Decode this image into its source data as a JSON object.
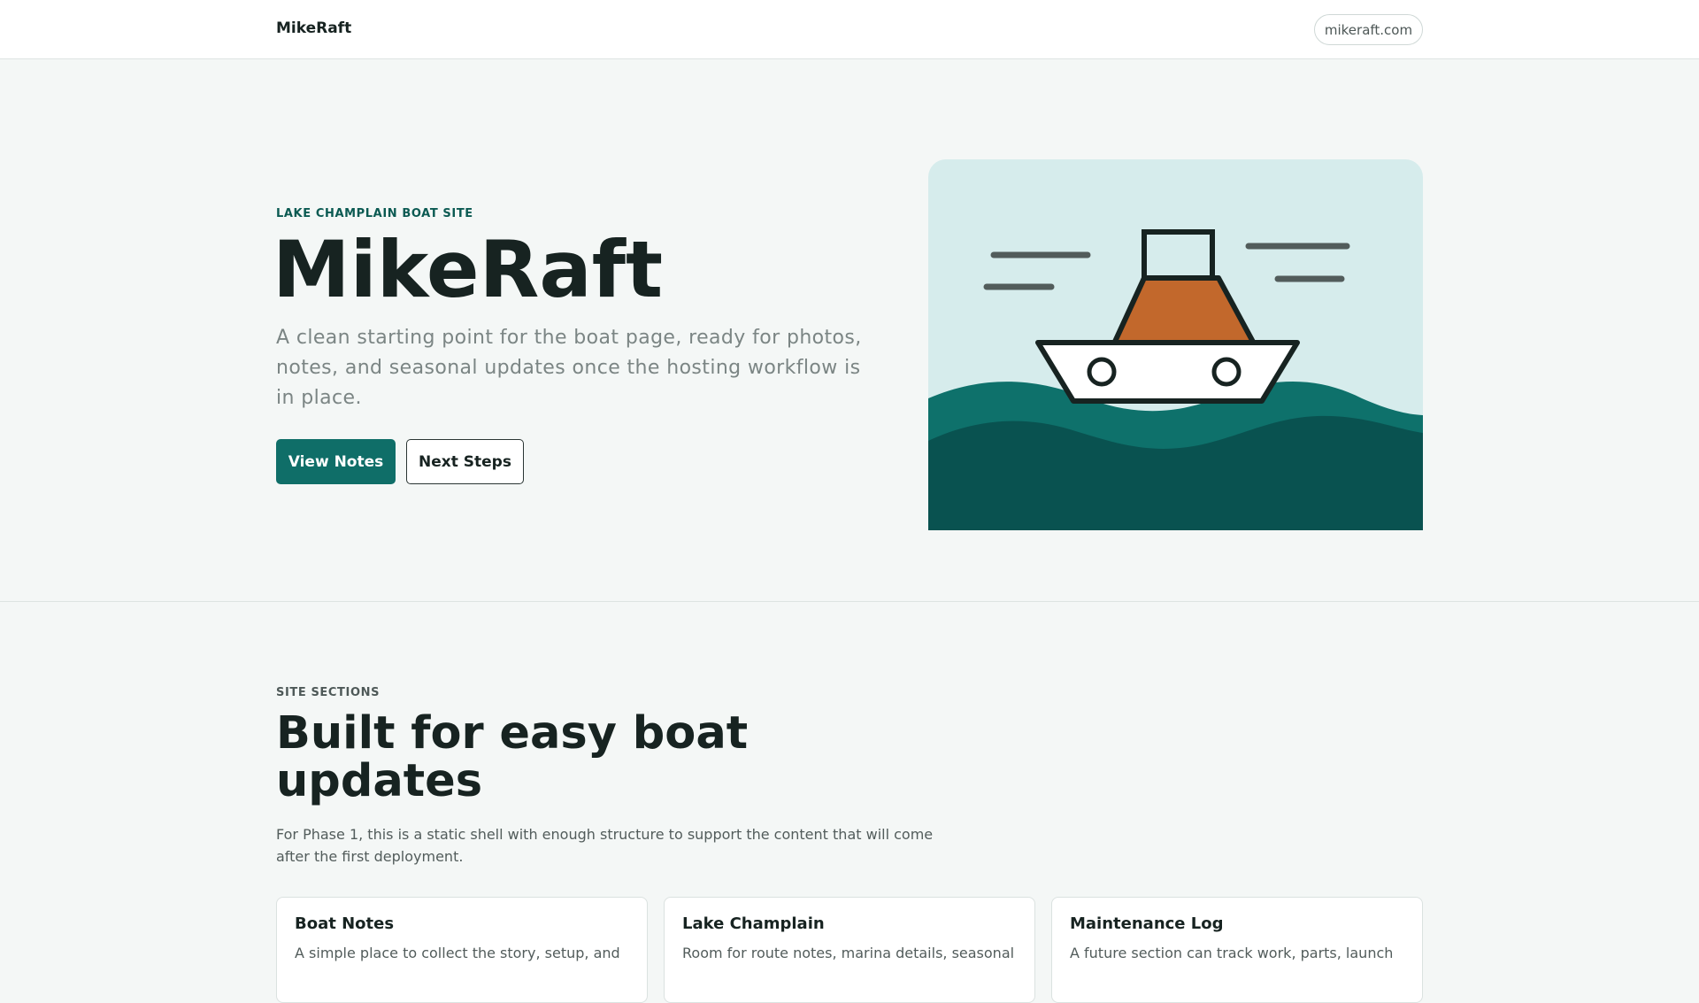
{
  "header": {
    "brand": "MikeRaft",
    "domain": "mikeraft.com"
  },
  "hero": {
    "eyebrow": "LAKE CHAMPLAIN BOAT SITE",
    "title": "MikeRaft",
    "subtitle": "A clean starting point for the boat page, ready for photos, notes, and seasonal updates once the hosting workflow is in place.",
    "primary_button": "View Notes",
    "secondary_button": "Next Steps",
    "illustration": "boat-on-waves-illustration"
  },
  "sections": {
    "eyebrow": "SITE SECTIONS",
    "title": "Built for easy boat updates",
    "description": "For Phase 1, this is a static shell with enough structure to support the content that will come after the first deployment.",
    "cards": [
      {
        "title": "Boat Notes",
        "text": "A simple place to collect the story, setup, and"
      },
      {
        "title": "Lake Champlain",
        "text": "Room for route notes, marina details, seasonal"
      },
      {
        "title": "Maintenance Log",
        "text": "A future section can track work, parts, launch"
      }
    ]
  },
  "colors": {
    "accent": "#0f6e68",
    "sky": "#d6ecec",
    "wave_light": "#0e716b",
    "wave_dark": "#095250",
    "cabin": "#c2682c",
    "outline": "#172321"
  }
}
